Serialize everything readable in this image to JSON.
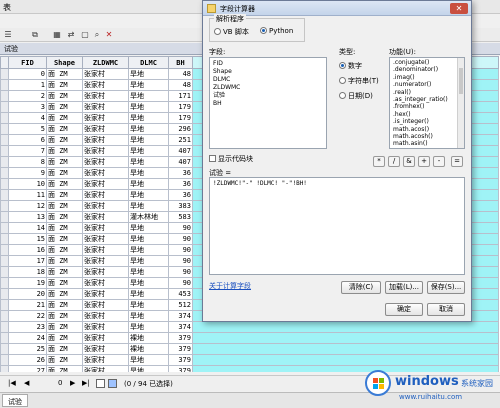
{
  "table_window": {
    "title": "表",
    "tab_label": "试验",
    "columns": [
      "FID",
      "Shape",
      "ZLDWMC",
      "DLMC",
      "BH",
      ""
    ],
    "rows": [
      [
        "0",
        "面 ZM",
        "张家村",
        "旱地",
        "48"
      ],
      [
        "1",
        "面 ZM",
        "张家村",
        "旱地",
        "48"
      ],
      [
        "2",
        "面 ZM",
        "张家村",
        "旱地",
        "171"
      ],
      [
        "3",
        "面 ZM",
        "张家村",
        "旱地",
        "179"
      ],
      [
        "4",
        "面 ZM",
        "张家村",
        "旱地",
        "179"
      ],
      [
        "5",
        "面 ZM",
        "张家村",
        "旱地",
        "296"
      ],
      [
        "6",
        "面 ZM",
        "张家村",
        "旱地",
        "251"
      ],
      [
        "7",
        "面 ZM",
        "张家村",
        "旱地",
        "407"
      ],
      [
        "8",
        "面 ZM",
        "张家村",
        "旱地",
        "407"
      ],
      [
        "9",
        "面 ZM",
        "张家村",
        "旱地",
        "36"
      ],
      [
        "10",
        "面 ZM",
        "张家村",
        "旱地",
        "36"
      ],
      [
        "11",
        "面 ZM",
        "张家村",
        "旱地",
        "36"
      ],
      [
        "12",
        "面 ZM",
        "张家村",
        "旱地",
        "383"
      ],
      [
        "13",
        "面 ZM",
        "张家村",
        "灌木林地",
        "583"
      ],
      [
        "14",
        "面 ZM",
        "张家村",
        "旱地",
        "90"
      ],
      [
        "15",
        "面 ZM",
        "张家村",
        "旱地",
        "90"
      ],
      [
        "16",
        "面 ZM",
        "张家村",
        "旱地",
        "90"
      ],
      [
        "17",
        "面 ZM",
        "张家村",
        "旱地",
        "90"
      ],
      [
        "18",
        "面 ZM",
        "张家村",
        "旱地",
        "90"
      ],
      [
        "19",
        "面 ZM",
        "张家村",
        "旱地",
        "90"
      ],
      [
        "20",
        "面 ZM",
        "张家村",
        "旱地",
        "453"
      ],
      [
        "21",
        "面 ZM",
        "张家村",
        "旱地",
        "512"
      ],
      [
        "22",
        "面 ZM",
        "张家村",
        "旱地",
        "374"
      ],
      [
        "23",
        "面 ZM",
        "张家村",
        "旱地",
        "374"
      ],
      [
        "24",
        "面 ZM",
        "张家村",
        "裸地",
        "379"
      ],
      [
        "25",
        "面 ZM",
        "张家村",
        "裸地",
        "379"
      ],
      [
        "26",
        "面 ZM",
        "张家村",
        "旱地",
        "379"
      ],
      [
        "27",
        "面 ZM",
        "张家村",
        "旱地",
        "379"
      ]
    ],
    "nav": {
      "first": "|◀",
      "prev": "◀",
      "record": "0",
      "next": "▶",
      "last": "▶|",
      "status": "(0 / 94 已选择)"
    },
    "bottom_tab": "试验",
    "highlight_color": "#9ff3f6"
  },
  "dialog": {
    "title": "字段计算器",
    "parser_legend": "解析程序",
    "parser_options": [
      "VB 脚本",
      "Python"
    ],
    "fields_label": "字段:",
    "fields": [
      "FID",
      "Shape",
      "DLMC",
      "ZLDWMC",
      "试验",
      "BH"
    ],
    "type_label": "类型:",
    "types": [
      "数字",
      "字符串(T)",
      "日期(D)"
    ],
    "functions_label": "功能(U):",
    "functions": [
      ".conjugate()",
      ".denominator()",
      ".imag()",
      ".numerator()",
      ".real()",
      ".as_integer_ratio()",
      ".fromhex()",
      ".hex()",
      ".is_integer()",
      "math.acos()",
      "math.acosh()",
      "math.asin()"
    ],
    "show_codeblock": "显示代码块",
    "operators": [
      "*",
      "/",
      "&",
      "+",
      "-",
      "="
    ],
    "expr_label": "试验 =",
    "expression": "!ZLDWMC!\"-\" !DLMC! \"-\"!BH!",
    "help_link": "关于计算字段",
    "buttons": {
      "clear": "清除(C)",
      "load": "加载(L)...",
      "save": "保存(S)...",
      "ok": "确定",
      "cancel": "取消"
    }
  },
  "watermark": {
    "brand": "windows",
    "brand_cn": "系统家园",
    "url": "www.ruihaitu.com"
  }
}
